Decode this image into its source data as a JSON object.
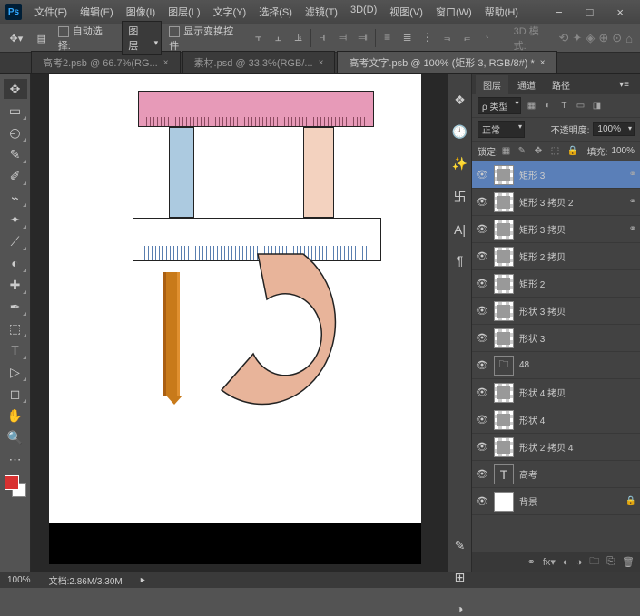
{
  "titlebar": {
    "logo": "Ps",
    "menus": [
      "文件(F)",
      "编辑(E)",
      "图像(I)",
      "图层(L)",
      "文字(Y)",
      "选择(S)",
      "滤镜(T)",
      "3D(D)",
      "视图(V)",
      "窗口(W)",
      "帮助(H)"
    ],
    "min": "−",
    "max": "□",
    "close": "×"
  },
  "optbar": {
    "auto_select_label": "自动选择:",
    "auto_select_value": "图层",
    "show_transform": "显示变换控件",
    "mode3d_label": "3D 模式:"
  },
  "tabs": [
    {
      "label": "高考2.psb @ 66.7%(RG...",
      "active": false
    },
    {
      "label": "素材.psd @ 33.3%(RGB/...",
      "active": false
    },
    {
      "label": "高考文字.psb @ 100% (矩形 3, RGB/8#) *",
      "active": true
    }
  ],
  "rightcol_icons": [
    "❖",
    "🕘",
    "✨",
    "卐",
    "A|",
    "¶"
  ],
  "panel": {
    "tabs": [
      "图层",
      "通道",
      "路径"
    ],
    "kind_label": "ρ 类型",
    "blend_mode": "正常",
    "opacity_label": "不透明度:",
    "opacity_value": "100%",
    "lock_label": "锁定:",
    "fill_label": "填充:",
    "fill_value": "100%"
  },
  "layers": [
    {
      "eye": "👁",
      "name": "矩形 3",
      "link": "⚭",
      "selected": true,
      "kind": "shape"
    },
    {
      "eye": "👁",
      "name": "矩形 3 拷贝 2",
      "link": "⚭",
      "kind": "shape"
    },
    {
      "eye": "👁",
      "name": "矩形 3 拷贝",
      "link": "⚭",
      "kind": "shape"
    },
    {
      "eye": "👁",
      "name": "矩形 2 拷贝",
      "link": "",
      "kind": "shape"
    },
    {
      "eye": "👁",
      "name": "矩形 2",
      "link": "",
      "kind": "shape"
    },
    {
      "eye": "👁",
      "name": "形状 3 拷贝",
      "link": "",
      "kind": "shape"
    },
    {
      "eye": "👁",
      "name": "形状 3",
      "link": "",
      "kind": "shape"
    },
    {
      "eye": "👁",
      "name": "48",
      "link": "",
      "kind": "folder"
    },
    {
      "eye": "👁",
      "name": "形状 4 拷贝",
      "link": "",
      "kind": "shape"
    },
    {
      "eye": "👁",
      "name": "形状 4",
      "link": "",
      "kind": "shape"
    },
    {
      "eye": "👁",
      "name": "形状 2 拷贝 4",
      "link": "",
      "kind": "shape"
    },
    {
      "eye": "👁",
      "name": "高考",
      "link": "",
      "kind": "text"
    },
    {
      "eye": "👁",
      "name": "背景",
      "link": "🔒",
      "kind": "bg"
    }
  ],
  "status": {
    "zoom": "100%",
    "doc": "文档:2.86M/3.30M"
  },
  "tools": [
    "✥",
    "▭",
    "◵",
    "✎",
    "✐",
    "⌁",
    "✦",
    "⟋",
    "◐",
    "✚",
    "✒",
    "⬚",
    "T",
    "▷",
    "◻",
    "✋",
    "🔍",
    "⋯"
  ]
}
